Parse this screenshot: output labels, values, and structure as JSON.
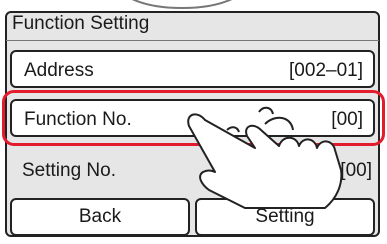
{
  "window": {
    "title": "Function Setting"
  },
  "rows": [
    {
      "label": "Address",
      "value": "[002–01]"
    },
    {
      "label": "Function No.",
      "value": "[00]"
    }
  ],
  "setting_row": {
    "label": "Setting No.",
    "value": "[00]"
  },
  "buttons": {
    "back": "Back",
    "setting": "Setting"
  },
  "focus_color": "#e21c2c",
  "icons": {
    "pointer": "hand-pointer-icon"
  }
}
